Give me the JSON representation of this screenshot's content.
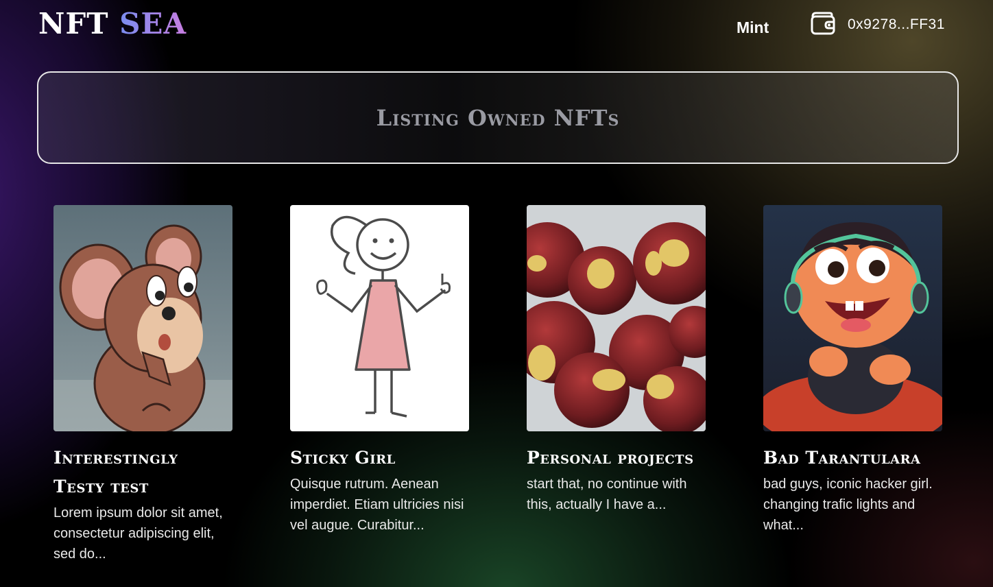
{
  "header": {
    "logo_part1": "NFT",
    "logo_part2": "SEA",
    "nav_mint": "Mint",
    "wallet_address": "0x9278...FF31",
    "wallet_icon": "wallet-icon"
  },
  "banner": {
    "title": "Listing Owned NFTs"
  },
  "cards": [
    {
      "title": "Interestingly Testy test",
      "description": "Lorem ipsum dolor sit amet, consectetur adipiscing elit, sed do...",
      "image": "cartoon-mouse-image"
    },
    {
      "title": "Sticky Girl",
      "description": "Quisque rutrum. Aenean imperdiet. Etiam ultricies nisi vel augue. Curabitur...",
      "image": "stick-figure-girl-image"
    },
    {
      "title": "Personal projects",
      "description": "start that, no continue with this, actually I have a...",
      "image": "apples-image"
    },
    {
      "title": "Bad Tarantulara",
      "description": "bad guys, iconic hacker girl. changing trafic lights and what...",
      "image": "hacker-girl-cartoon-image"
    }
  ],
  "colors": {
    "logo_gradient_start": "#7a8df0",
    "logo_gradient_end": "#c77de0",
    "banner_title": "#9a9ba3",
    "background": "#000000"
  }
}
